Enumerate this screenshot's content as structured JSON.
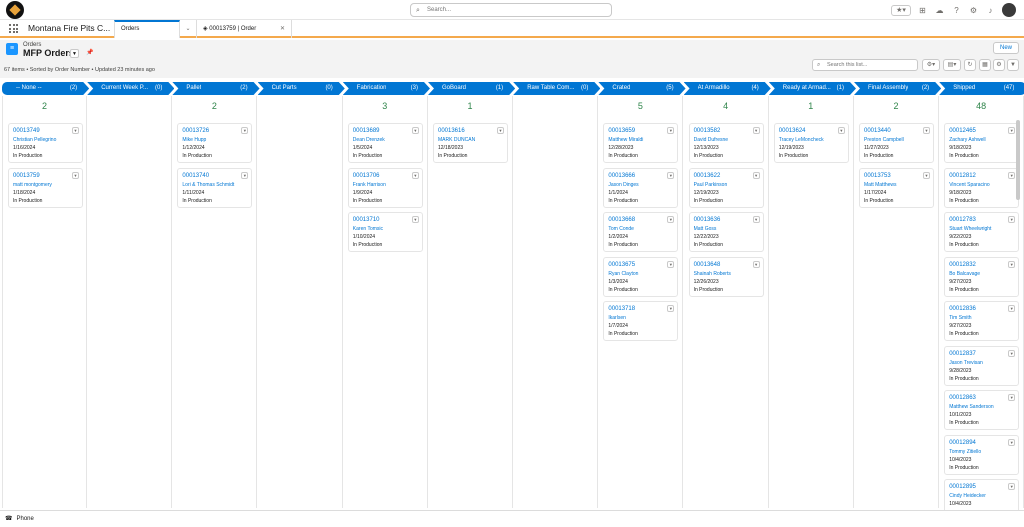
{
  "global": {
    "search_placeholder": "Search...",
    "favorites": "★▾"
  },
  "tabs": {
    "app_name": "Montana Fire Pits C...",
    "active": "Orders",
    "record": "00013759 | Order"
  },
  "header": {
    "object": "Orders",
    "list_view": "MFP Orders",
    "meta": "67 items • Sorted by Order Number • Updated 23 minutes ago",
    "new_label": "New",
    "list_search_placeholder": "Search this list..."
  },
  "stages": [
    {
      "label": "-- None --",
      "count": "(2)",
      "total": "2"
    },
    {
      "label": "Current Week P...",
      "count": "(0)",
      "total": ""
    },
    {
      "label": "Pallet",
      "count": "(2)",
      "total": "2"
    },
    {
      "label": "Cut Parts",
      "count": "(0)",
      "total": ""
    },
    {
      "label": "Fabrication",
      "count": "(3)",
      "total": "3"
    },
    {
      "label": "GoBoard",
      "count": "(1)",
      "total": "1"
    },
    {
      "label": "Raw Table Com...",
      "count": "(0)",
      "total": ""
    },
    {
      "label": "Crated",
      "count": "(5)",
      "total": "5"
    },
    {
      "label": "At Armadillo",
      "count": "(4)",
      "total": "4"
    },
    {
      "label": "Ready at Armad...",
      "count": "(1)",
      "total": "1"
    },
    {
      "label": "Final Assembly",
      "count": "(2)",
      "total": "2"
    },
    {
      "label": "Shipped",
      "count": "(47)",
      "total": "48"
    }
  ],
  "cards": [
    [
      {
        "num": "00013749",
        "name": "Christian Pellegrino",
        "date": "1/16/2024",
        "status": "In Production"
      },
      {
        "num": "00013759",
        "name": "matt montgomery",
        "date": "1/18/2024",
        "status": "In Production"
      }
    ],
    [],
    [
      {
        "num": "00013726",
        "name": "Mike Hupp",
        "date": "1/12/2024",
        "status": "In Production"
      },
      {
        "num": "00013740",
        "name": "Lori & Thomas Schmidt",
        "date": "1/11/2024",
        "status": "In Production"
      }
    ],
    [],
    [
      {
        "num": "00013689",
        "name": "Dean Drenzek",
        "date": "1/5/2024",
        "status": "In Production"
      },
      {
        "num": "00013706",
        "name": "Frank Harrison",
        "date": "1/9/2024",
        "status": "In Production"
      },
      {
        "num": "00013710",
        "name": "Karen Tomsic",
        "date": "1/10/2024",
        "status": "In Production"
      }
    ],
    [
      {
        "num": "00013616",
        "name": "MARK DUNCAN",
        "date": "12/18/2023",
        "status": "In Production"
      }
    ],
    [],
    [
      {
        "num": "00013659",
        "name": "Matthew Miraldi",
        "date": "12/28/2023",
        "status": "In Production"
      },
      {
        "num": "00013666",
        "name": "Jason Dinges",
        "date": "1/1/2024",
        "status": "In Production"
      },
      {
        "num": "00013668",
        "name": "Tom Conde",
        "date": "1/2/2024",
        "status": "In Production"
      },
      {
        "num": "00013675",
        "name": "Ryan Clayton",
        "date": "1/3/2024",
        "status": "In Production"
      },
      {
        "num": "00013718",
        "name": "Ikarlsen",
        "date": "1/7/2024",
        "status": "In Production"
      }
    ],
    [
      {
        "num": "00013582",
        "name": "David Dufresne",
        "date": "12/13/2023",
        "status": "In Production"
      },
      {
        "num": "00013622",
        "name": "Paul Parkinson",
        "date": "12/19/2023",
        "status": "In Production"
      },
      {
        "num": "00013636",
        "name": "Matt Goss",
        "date": "12/22/2023",
        "status": "In Production"
      },
      {
        "num": "00013648",
        "name": "Shainah Roberts",
        "date": "12/26/2023",
        "status": "In Production"
      }
    ],
    [
      {
        "num": "00013624",
        "name": "Tracey LeMoncheck",
        "date": "12/19/2023",
        "status": "In Production"
      }
    ],
    [
      {
        "num": "00013440",
        "name": "Preston Campbell",
        "date": "11/27/2023",
        "status": "In Production"
      },
      {
        "num": "00013753",
        "name": "Matt Matthews",
        "date": "1/17/2024",
        "status": "In Production"
      }
    ],
    [
      {
        "num": "00012465",
        "name": "Zachary Ashwell",
        "date": "9/18/2023",
        "status": "In Production"
      },
      {
        "num": "00012812",
        "name": "Vincent Sparacino",
        "date": "9/18/2023",
        "status": "In Production"
      },
      {
        "num": "00012783",
        "name": "Stuart Wheelwright",
        "date": "9/22/2023",
        "status": "In Production"
      },
      {
        "num": "00012832",
        "name": "Bo Balcavage",
        "date": "9/27/2023",
        "status": "In Production"
      },
      {
        "num": "00012836",
        "name": "Tim Smith",
        "date": "9/27/2023",
        "status": "In Production"
      },
      {
        "num": "00012837",
        "name": "Jason Trevisan",
        "date": "9/28/2023",
        "status": "In Production"
      },
      {
        "num": "00012863",
        "name": "Matthew Sanderson",
        "date": "10/1/2023",
        "status": "In Production"
      },
      {
        "num": "00012894",
        "name": "Tommy Zitiello",
        "date": "10/4/2023",
        "status": "In Production"
      },
      {
        "num": "00012895",
        "name": "Cindy Heidecker",
        "date": "10/4/2023",
        "status": ""
      }
    ]
  ],
  "footer": {
    "label": "Phone"
  },
  "colors": {
    "brand": "#0176d3",
    "count": "#2e844a",
    "tab_accent": "#f4a94c"
  }
}
